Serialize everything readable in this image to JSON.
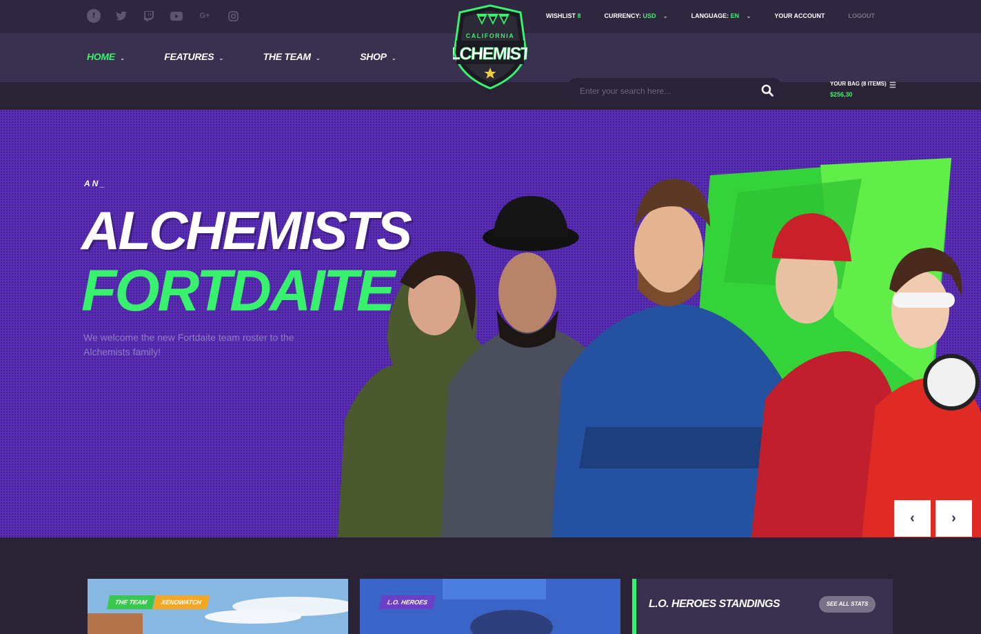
{
  "socials": [
    "facebook-icon",
    "twitter-icon",
    "twitch-icon",
    "youtube-icon",
    "google-plus-icon",
    "instagram-icon"
  ],
  "top": {
    "wishlist_label": "WISHLIST",
    "wishlist_count": "8",
    "currency_label": "CURRENCY:",
    "currency_value": "USD",
    "language_label": "LANGUAGE:",
    "language_value": "EN",
    "account": "YOUR ACCOUNT",
    "logout": "LOGOUT"
  },
  "nav": {
    "home": "HOME",
    "features": "FEATURES",
    "team": "THE TEAM",
    "shop": "SHOP"
  },
  "logo": {
    "top": "CALIFORNIA",
    "main": "ALCHEMISTS"
  },
  "search": {
    "placeholder": "Enter your search here..."
  },
  "bag": {
    "label": "YOUR BAG (8 ITEMS)",
    "price": "$256,30"
  },
  "hero": {
    "eyebrow": "AN_",
    "title1": "ALCHEMISTS",
    "title2": "FORTDAITE",
    "subtitle": "We welcome the new Fortdaite team roster to the Alchemists family!",
    "prev": "‹",
    "next": "›"
  },
  "cards": {
    "c1_badge1": "THE TEAM",
    "c1_badge2": "XENOWATCH",
    "c2_badge1": "L.O. HEROES",
    "standings_title": "L.O. HEROES STANDINGS",
    "see_all": "SEE ALL STATS"
  },
  "colors": {
    "accent": "#38f26d",
    "bg": "#2a2336",
    "nav": "#3a3150",
    "hero": "#5b2db8"
  }
}
